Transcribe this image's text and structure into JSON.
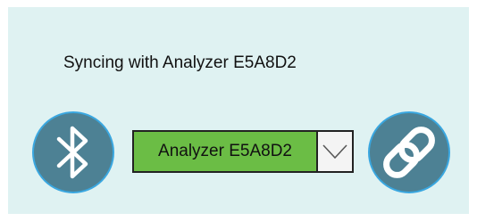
{
  "status": {
    "message": "Syncing with Analyzer E5A8D2"
  },
  "device_select": {
    "selected": "Analyzer E5A8D2"
  },
  "icons": {
    "left_button": "bluetooth-icon",
    "right_button": "link-icon",
    "dropdown": "chevron-down-icon"
  },
  "colors": {
    "panel_background": "#dff2f2",
    "button_fill": "#4d8194",
    "button_border": "#3aa7e0",
    "selected_value_fill": "#6bbd45"
  }
}
